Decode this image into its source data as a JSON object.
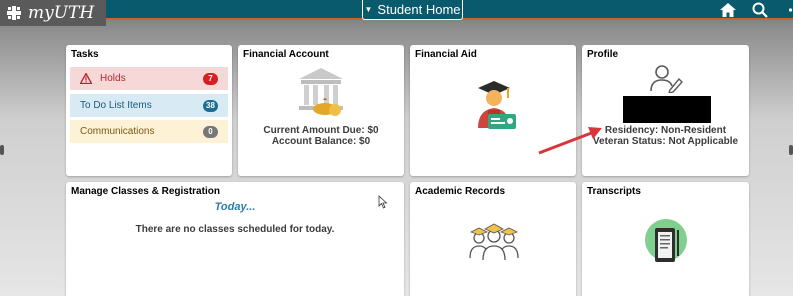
{
  "header": {
    "logo_text": "myUTH",
    "home_button_label": "Student Home",
    "icons": [
      "home-icon",
      "search-icon",
      "menu-icon"
    ]
  },
  "tiles": {
    "tasks": {
      "title": "Tasks",
      "rows": [
        {
          "label": "Holds",
          "count": "7",
          "color": "#d42020"
        },
        {
          "label": "To Do List Items",
          "count": "38",
          "color": "#1b6f91"
        },
        {
          "label": "Communications",
          "count": "0",
          "color": "#777777"
        }
      ]
    },
    "financial_account": {
      "title": "Financial Account",
      "current_amount_due": "Current Amount Due: $0",
      "account_balance": "Account Balance: $0"
    },
    "financial_aid": {
      "title": "Financial Aid"
    },
    "profile": {
      "title": "Profile",
      "residency": "Residency: Non-Resident",
      "veteran_status": "Veteran Status: Not Applicable"
    },
    "manage_classes": {
      "title": "Manage Classes & Registration",
      "today": "Today...",
      "message": "There are no classes scheduled for today."
    },
    "academic_records": {
      "title": "Academic Records"
    },
    "transcripts": {
      "title": "Transcripts"
    }
  },
  "colors": {
    "header_bg": "#0a5a6d",
    "header_accent": "#c8672b",
    "annotation_arrow": "#d9353b"
  }
}
